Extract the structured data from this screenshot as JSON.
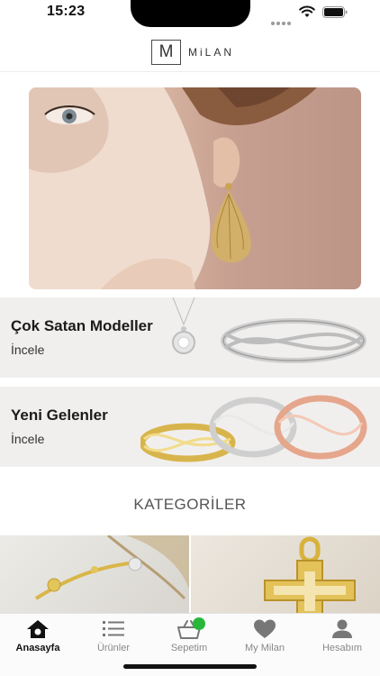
{
  "status_bar": {
    "time": "15:23"
  },
  "header": {
    "logo_mark": "M",
    "logo_text": "MiLAN"
  },
  "promos": [
    {
      "title": "Çok Satan Modeller",
      "link": "İncele"
    },
    {
      "title": "Yeni Gelenler",
      "link": "İncele"
    }
  ],
  "categories": {
    "title": "KATEGORİLER"
  },
  "tabs": [
    {
      "label": "Anasayfa",
      "icon": "home-icon",
      "active": true
    },
    {
      "label": "Ürünler",
      "icon": "list-icon"
    },
    {
      "label": "Sepetim",
      "icon": "basket-icon"
    },
    {
      "label": "My Milan",
      "icon": "heart-icon"
    },
    {
      "label": "Hesabım",
      "icon": "user-icon"
    }
  ],
  "colors": {
    "badge": "#26b83a",
    "promo_bg": "#f1efee"
  }
}
